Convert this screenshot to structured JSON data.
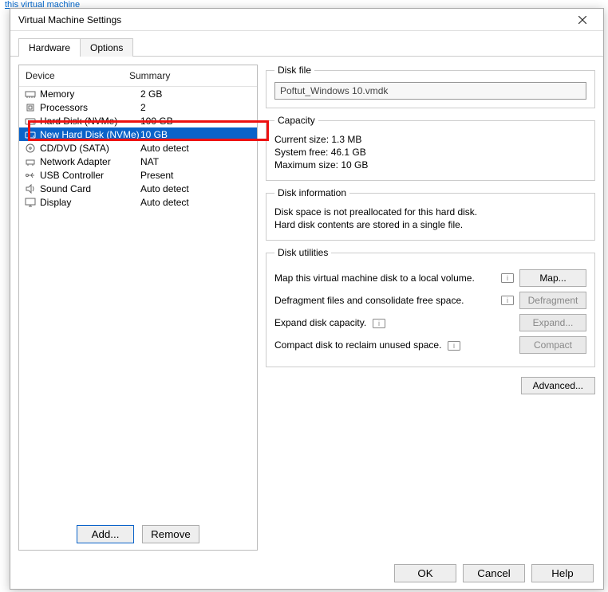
{
  "backdrop_link": "this virtual machine",
  "window": {
    "title": "Virtual Machine Settings"
  },
  "tabs": {
    "hardware": "Hardware",
    "options": "Options"
  },
  "device_header": {
    "device": "Device",
    "summary": "Summary"
  },
  "devices": [
    {
      "name": "Memory",
      "summary": "2 GB",
      "icon": "memory"
    },
    {
      "name": "Processors",
      "summary": "2",
      "icon": "cpu"
    },
    {
      "name": "Hard Disk (NVMe)",
      "summary": "100 GB",
      "icon": "disk"
    },
    {
      "name": "New Hard Disk (NVMe)",
      "summary": "10 GB",
      "icon": "disk",
      "selected": true
    },
    {
      "name": "CD/DVD (SATA)",
      "summary": "Auto detect",
      "icon": "cd"
    },
    {
      "name": "Network Adapter",
      "summary": "NAT",
      "icon": "net"
    },
    {
      "name": "USB Controller",
      "summary": "Present",
      "icon": "usb"
    },
    {
      "name": "Sound Card",
      "summary": "Auto detect",
      "icon": "sound"
    },
    {
      "name": "Display",
      "summary": "Auto detect",
      "icon": "display"
    }
  ],
  "left_buttons": {
    "add": "Add...",
    "remove": "Remove"
  },
  "disk_file": {
    "legend": "Disk file",
    "path": "Poftut_Windows 10.vmdk"
  },
  "capacity": {
    "legend": "Capacity",
    "current_label": "Current size:",
    "current_value": "1.3 MB",
    "free_label": "System free:",
    "free_value": "46.1 GB",
    "max_label": "Maximum size:",
    "max_value": "10 GB"
  },
  "disk_info": {
    "legend": "Disk information",
    "line1": "Disk space is not preallocated for this hard disk.",
    "line2": "Hard disk contents are stored in a single file."
  },
  "utilities": {
    "legend": "Disk utilities",
    "map_label": "Map this virtual machine disk to a local volume.",
    "map_btn": "Map...",
    "defrag_label": "Defragment files and consolidate free space.",
    "defrag_btn": "Defragment",
    "expand_label": "Expand disk capacity.",
    "expand_btn": "Expand...",
    "compact_label": "Compact disk to reclaim unused space.",
    "compact_btn": "Compact"
  },
  "advanced_btn": "Advanced...",
  "footer": {
    "ok": "OK",
    "cancel": "Cancel",
    "help": "Help"
  }
}
